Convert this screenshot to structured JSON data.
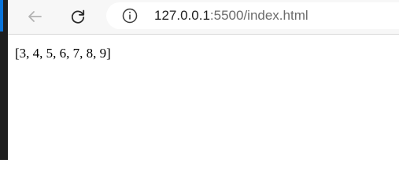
{
  "browser": {
    "url": {
      "host": "127.0.0.1",
      "path": ":5500/index.html"
    },
    "icons": {
      "back": "back-arrow-icon",
      "reload": "reload-icon",
      "site_info": "info-icon"
    },
    "colors": {
      "accent": "#0a74da",
      "toolbar": "#f7f7f7"
    }
  },
  "page": {
    "output_text": "[3, 4, 5, 6, 7, 8, 9]"
  }
}
